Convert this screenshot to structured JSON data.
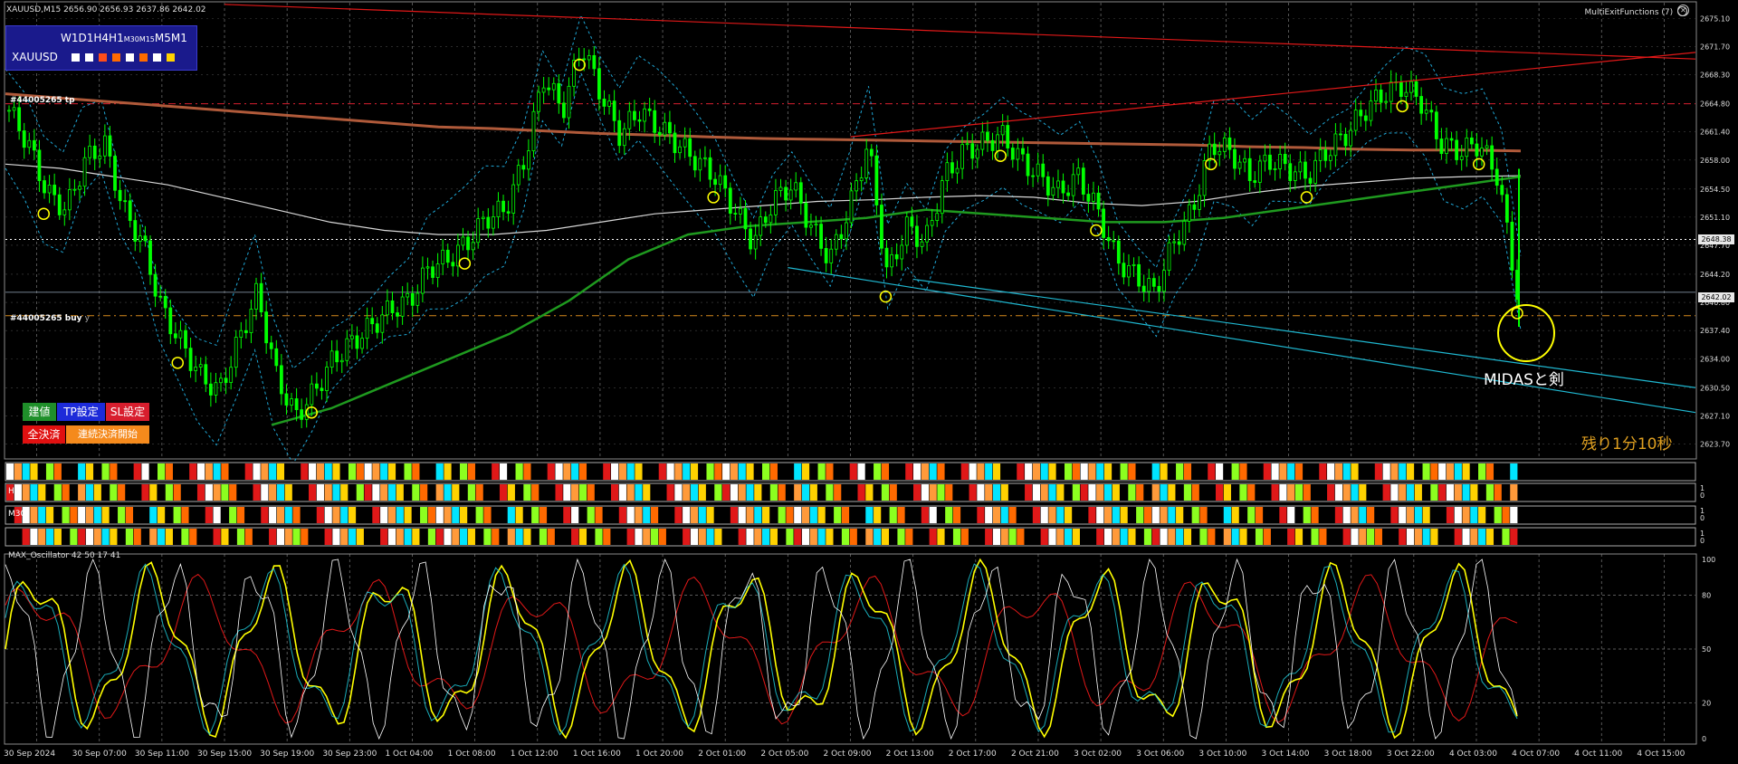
{
  "window": {
    "title": "XAUUSD,M15  2656.90 2656.93 2637.86 2642.02",
    "indicator_label": "MultiExitFunctions (7)"
  },
  "tf_panel": {
    "row1_parts": [
      "W1",
      "D1",
      "H4",
      "H1",
      "M30",
      "M15",
      "M5",
      "M1"
    ],
    "symbol": "XAUUSD",
    "box_colors": [
      "#ffffff",
      "#ffffff",
      "#ff4d1a",
      "#ff6a00",
      "#ffffff",
      "#ff6a00",
      "#ffffff",
      "#ffd200"
    ]
  },
  "hlines": {
    "tp_text": "#44005265 tp",
    "buy_text": "#44005265 buy",
    "buy_suffix": "y"
  },
  "buttons": {
    "entry": "建値",
    "tp": "TP設定",
    "sl": "SL設定",
    "close_all": "全決済",
    "chain_close": "連続決済開始"
  },
  "annotation": "MIDASと剣",
  "timer": "残り1分10秒",
  "strips": [
    {
      "label": "",
      "scale_top": "",
      "scale_bottom": ""
    },
    {
      "label": "H1",
      "scale_top": "1",
      "scale_bottom": "0"
    },
    {
      "label": "M30",
      "scale_top": "1",
      "scale_bottom": "0"
    },
    {
      "label": "",
      "scale_top": "1",
      "scale_bottom": "0"
    }
  ],
  "oscillator": {
    "title": "MAX_Oscillator 42 50 17 41",
    "ticks": [
      "100",
      "80",
      "50",
      "20",
      "0"
    ]
  },
  "price_tags": {
    "current": "2642.02",
    "line": "2648.38"
  },
  "colors": {
    "bull": "#00ff00",
    "bear": "#00ff00",
    "band": "#1fa7d6",
    "ma_brown": "#b05a3a",
    "ma_green": "#1f9a1f",
    "ma_white": "#d8d8d8",
    "trend_red": "#e01818",
    "trend_cyan": "#1fb7d0",
    "marker": "#ffff00"
  },
  "chart_data": {
    "type": "candlestick",
    "symbol": "XAUUSD",
    "timeframe": "M15",
    "ohlc_last": {
      "open": 2656.9,
      "high": 2656.93,
      "low": 2637.86,
      "close": 2642.02
    },
    "ylim": [
      2622.0,
      2677.0
    ],
    "price_ticks": [
      "2671.70",
      "2668.30",
      "2664.80",
      "2661.40",
      "2658.00",
      "2654.50",
      "2651.10",
      "2647.70",
      "2644.20",
      "2640.80",
      "2637.40",
      "2634.00",
      "2630.50",
      "2627.10",
      "2623.70",
      "2675.10"
    ],
    "x_ticks": [
      "30 Sep 2024",
      "30 Sep 07:00",
      "30 Sep 11:00",
      "30 Sep 15:00",
      "30 Sep 19:00",
      "30 Sep 23:00",
      "1 Oct 04:00",
      "1 Oct 08:00",
      "1 Oct 12:00",
      "1 Oct 16:00",
      "1 Oct 20:00",
      "2 Oct 01:00",
      "2 Oct 05:00",
      "2 Oct 09:00",
      "2 Oct 13:00",
      "2 Oct 17:00",
      "2 Oct 21:00",
      "3 Oct 02:00",
      "3 Oct 06:00",
      "3 Oct 10:00",
      "3 Oct 14:00",
      "3 Oct 18:00",
      "3 Oct 22:00",
      "4 Oct 03:00",
      "4 Oct 07:00",
      "4 Oct 11:00",
      "4 Oct 15:00"
    ],
    "close_path": [
      2664,
      2660,
      2654,
      2652,
      2658,
      2660,
      2652,
      2648,
      2640,
      2636,
      2632,
      2630,
      2636,
      2642,
      2632,
      2627,
      2630,
      2634,
      2636,
      2638,
      2640,
      2641,
      2645,
      2646,
      2648,
      2651,
      2652,
      2658,
      2668,
      2664,
      2672,
      2666,
      2661,
      2664,
      2662,
      2660,
      2658,
      2656,
      2652,
      2648,
      2653,
      2655,
      2650,
      2646,
      2652,
      2660,
      2644,
      2650,
      2648,
      2656,
      2659,
      2660,
      2661,
      2658,
      2656,
      2654,
      2656,
      2652,
      2646,
      2644,
      2642,
      2648,
      2652,
      2660,
      2659,
      2656,
      2658,
      2657,
      2656,
      2659,
      2661,
      2664,
      2666,
      2667,
      2665,
      2660,
      2659,
      2660,
      2656,
      2642
    ],
    "ma_brown_path": [
      2666,
      2665.5,
      2665,
      2664.5,
      2664,
      2663.5,
      2663,
      2662.5,
      2662,
      2661.8,
      2661.5,
      2661.2,
      2661,
      2660.8,
      2660.6,
      2660.5,
      2660.4,
      2660.3,
      2660.2,
      2660.1,
      2660,
      2659.9,
      2659.8,
      2659.6,
      2659.5,
      2659.3,
      2659.2,
      2659.2,
      2659.1
    ],
    "ma_white_path": [
      2657.5,
      2657,
      2656,
      2655,
      2653.5,
      2652,
      2650.5,
      2649.5,
      2649,
      2649,
      2649.5,
      2650.5,
      2651.5,
      2652,
      2652.5,
      2653,
      2653.2,
      2653.5,
      2653.7,
      2653.5,
      2652.8,
      2652.5,
      2653,
      2654,
      2654.8,
      2655.3,
      2655.8,
      2656,
      2656.1
    ],
    "ma_green_path": [
      2626,
      2628,
      2631,
      2634,
      2637,
      2641,
      2646,
      2649,
      2650,
      2650.5,
      2651,
      2652,
      2651.5,
      2651,
      2650.5,
      2650.5,
      2651,
      2652,
      2653,
      2654,
      2655,
      2656
    ],
    "trendlines": [
      {
        "color": "red",
        "from": [
          "30 Sep 15:00",
          2676.8
        ],
        "to": [
          "4 Oct 15:00",
          2670.2
        ]
      },
      {
        "color": "red",
        "from": [
          "2 Oct 09:00",
          2660.8
        ],
        "to": [
          "4 Oct 15:00",
          2671.0
        ]
      },
      {
        "color": "cyan",
        "from": [
          "2 Oct 05:00",
          2645.0
        ],
        "to": [
          "4 Oct 15:00",
          2627.5
        ]
      },
      {
        "color": "cyan",
        "from": [
          "2 Oct 13:00",
          2643.6
        ],
        "to": [
          "4 Oct 15:00",
          2630.5
        ]
      }
    ],
    "horizontal_levels": [
      {
        "name": "tp",
        "price": 2664.8,
        "style": "dashed",
        "color": "#d81e2e"
      },
      {
        "name": "buy",
        "price": 2639.2,
        "style": "dashed",
        "color": "#d88a1c"
      },
      {
        "name": "line",
        "price": 2648.4,
        "style": "dotted",
        "color": "#ffffff"
      }
    ],
    "oscillator_lines": [
      {
        "name": "white",
        "color": "#ffffff"
      },
      {
        "name": "yellow",
        "color": "#ffff00"
      },
      {
        "name": "cyan",
        "color": "#1fd6e6"
      },
      {
        "name": "red",
        "color": "#e01818"
      }
    ],
    "grid": true,
    "legend": "none"
  }
}
